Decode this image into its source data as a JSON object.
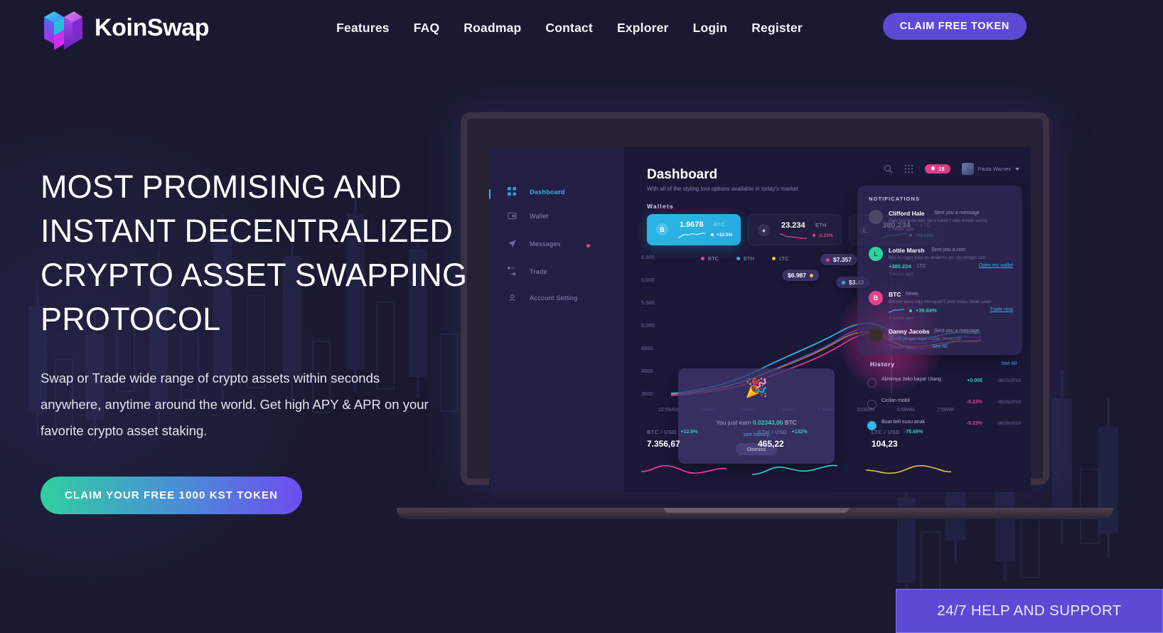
{
  "brand": {
    "name": "KoinSwap",
    "logo_icon": "cube-logo-icon"
  },
  "nav": {
    "items": [
      {
        "label": "Features"
      },
      {
        "label": "FAQ"
      },
      {
        "label": "Roadmap"
      },
      {
        "label": "Contact"
      },
      {
        "label": "Explorer"
      },
      {
        "label": "Login"
      },
      {
        "label": "Register"
      }
    ],
    "cta_label": "CLAIM FREE TOKEN"
  },
  "hero": {
    "headline": "MOST PROMISING AND INSTANT DECENTRALIZED CRYPTO ASSET SWAPPING PROTOCOL",
    "subcopy": "Swap or Trade wide range of crypto assets within seconds anywhere, anytime around the world. Get high APY & APR on your favorite crypto asset staking.",
    "cta_label": "CLAIM YOUR FREE 1000 KST TOKEN"
  },
  "support": {
    "label": "24/7 HELP AND SUPPORT"
  },
  "dashboard": {
    "title": "Dashboard",
    "subtitle": "With all of the styling tool options available in today's market",
    "wallets_label": "Wallets",
    "sidebar": [
      {
        "label": "Dashboard",
        "icon": "grid-icon",
        "active": true
      },
      {
        "label": "Wallet",
        "icon": "wallet-icon",
        "active": false
      },
      {
        "label": "Messages",
        "icon": "send-icon",
        "active": false,
        "dot": true
      },
      {
        "label": "Trade",
        "icon": "trade-icon",
        "active": false
      },
      {
        "label": "Account Setting",
        "icon": "settings-icon",
        "active": false
      }
    ],
    "toolbar": {
      "search_icon": "search-icon",
      "apps_icon": "grid-apps-icon",
      "notification_count": "15",
      "user_name": "Pasta Wames"
    },
    "wallets": [
      {
        "symbol": "B",
        "amount": "1.9678",
        "ticker": "BTC",
        "change": "+12.5%"
      },
      {
        "symbol": "E",
        "amount": "23.234",
        "ticker": "ETH",
        "change": "-5.23%"
      },
      {
        "symbol": "L",
        "amount": "380.234",
        "ticker": "LTC",
        "change": "+29.69%"
      }
    ],
    "legend": [
      {
        "label": "BTC",
        "color": "#e8418b"
      },
      {
        "label": "ETH",
        "color": "#2fb7e8"
      },
      {
        "label": "LTC",
        "color": "#f0c33c"
      }
    ],
    "y_axis": [
      "6.500",
      "6.000",
      "5.500",
      "5.000",
      "4500",
      "4000",
      "3500"
    ],
    "x_axis": [
      "12:59AM",
      "1:59AM",
      "2:59AM",
      "3:59AM",
      "4:59AM",
      "5:59AM",
      "6:59AM",
      "7:59AM"
    ],
    "tooltips": [
      {
        "value": "$6.987",
        "color": "#f0c33c"
      },
      {
        "value": "$7.357",
        "color": "#e8418b"
      },
      {
        "value": "$3.43",
        "color": "#2fb7e8"
      }
    ],
    "earn_popup": {
      "prefix": "You just earn",
      "amount": "0.02343,00",
      "unit": "BTC",
      "link": "see history",
      "button": "Dismiss"
    },
    "notifications": {
      "header": "NOTIFICATIONS",
      "see_all": "See All",
      "items": [
        {
          "name": "Clifford Hale",
          "action": "Sent you a message",
          "text": "Halo bro brok wes pero kaleh? wes kuliah urung",
          "time": "2 hours ago",
          "avatar_color": "#4c4668"
        },
        {
          "name": "Lottie Marsh",
          "action": "Sent you a coin",
          "text": "Bro iki nggo tuku es anakmu yo, ojo dinggo judi",
          "value": "+380.234",
          "unit": "LTC",
          "link": "Open my wallet",
          "time": "3 hours ago",
          "avatar_color": "#2fd3a0"
        },
        {
          "name": "BTC",
          "action": "News",
          "text": "Bitcoin baru saja menguat 5 poin kalau tidak salah",
          "value": "+39.69%",
          "link": "Trade now",
          "time": "3 hours ago",
          "avatar_color": "#e8418b"
        },
        {
          "name": "Danny Jacobs",
          "action": "Sent you a message",
          "text": "Besok jangan lupa mabar minecraft",
          "time": "2 hours ago",
          "avatar_color": "#3a2f28"
        }
      ]
    },
    "history": {
      "header": "History",
      "see_all": "See All",
      "items": [
        {
          "text": "Akhirnya Joko bayar Utang",
          "value": "+0.005",
          "date": "08/25/2018",
          "positive": true
        },
        {
          "text": "Cicilan mobil",
          "value": "-5.23%",
          "date": "08/26/2018",
          "positive": false
        },
        {
          "text": "Buat beli susu anak",
          "value": "-5.23%",
          "date": "08/26/2018",
          "positive": false
        }
      ]
    },
    "bottom_stats": [
      {
        "pair": "BTC / USD",
        "change": "+12.5%",
        "value": "7.356,67",
        "positive": true
      },
      {
        "pair": "ETH / USD",
        "change": "+132%",
        "value": "465,22",
        "positive": true
      },
      {
        "pair": "LTC / USD",
        "change": "-75.69%",
        "value": "104,23",
        "positive": false
      }
    ]
  },
  "colors": {
    "page_bg": "#191a31",
    "accent_purple": "#5b4ad4",
    "accent_cyan": "#2fb7e8",
    "accent_green": "#30cfa0",
    "accent_pink": "#e8418b"
  }
}
